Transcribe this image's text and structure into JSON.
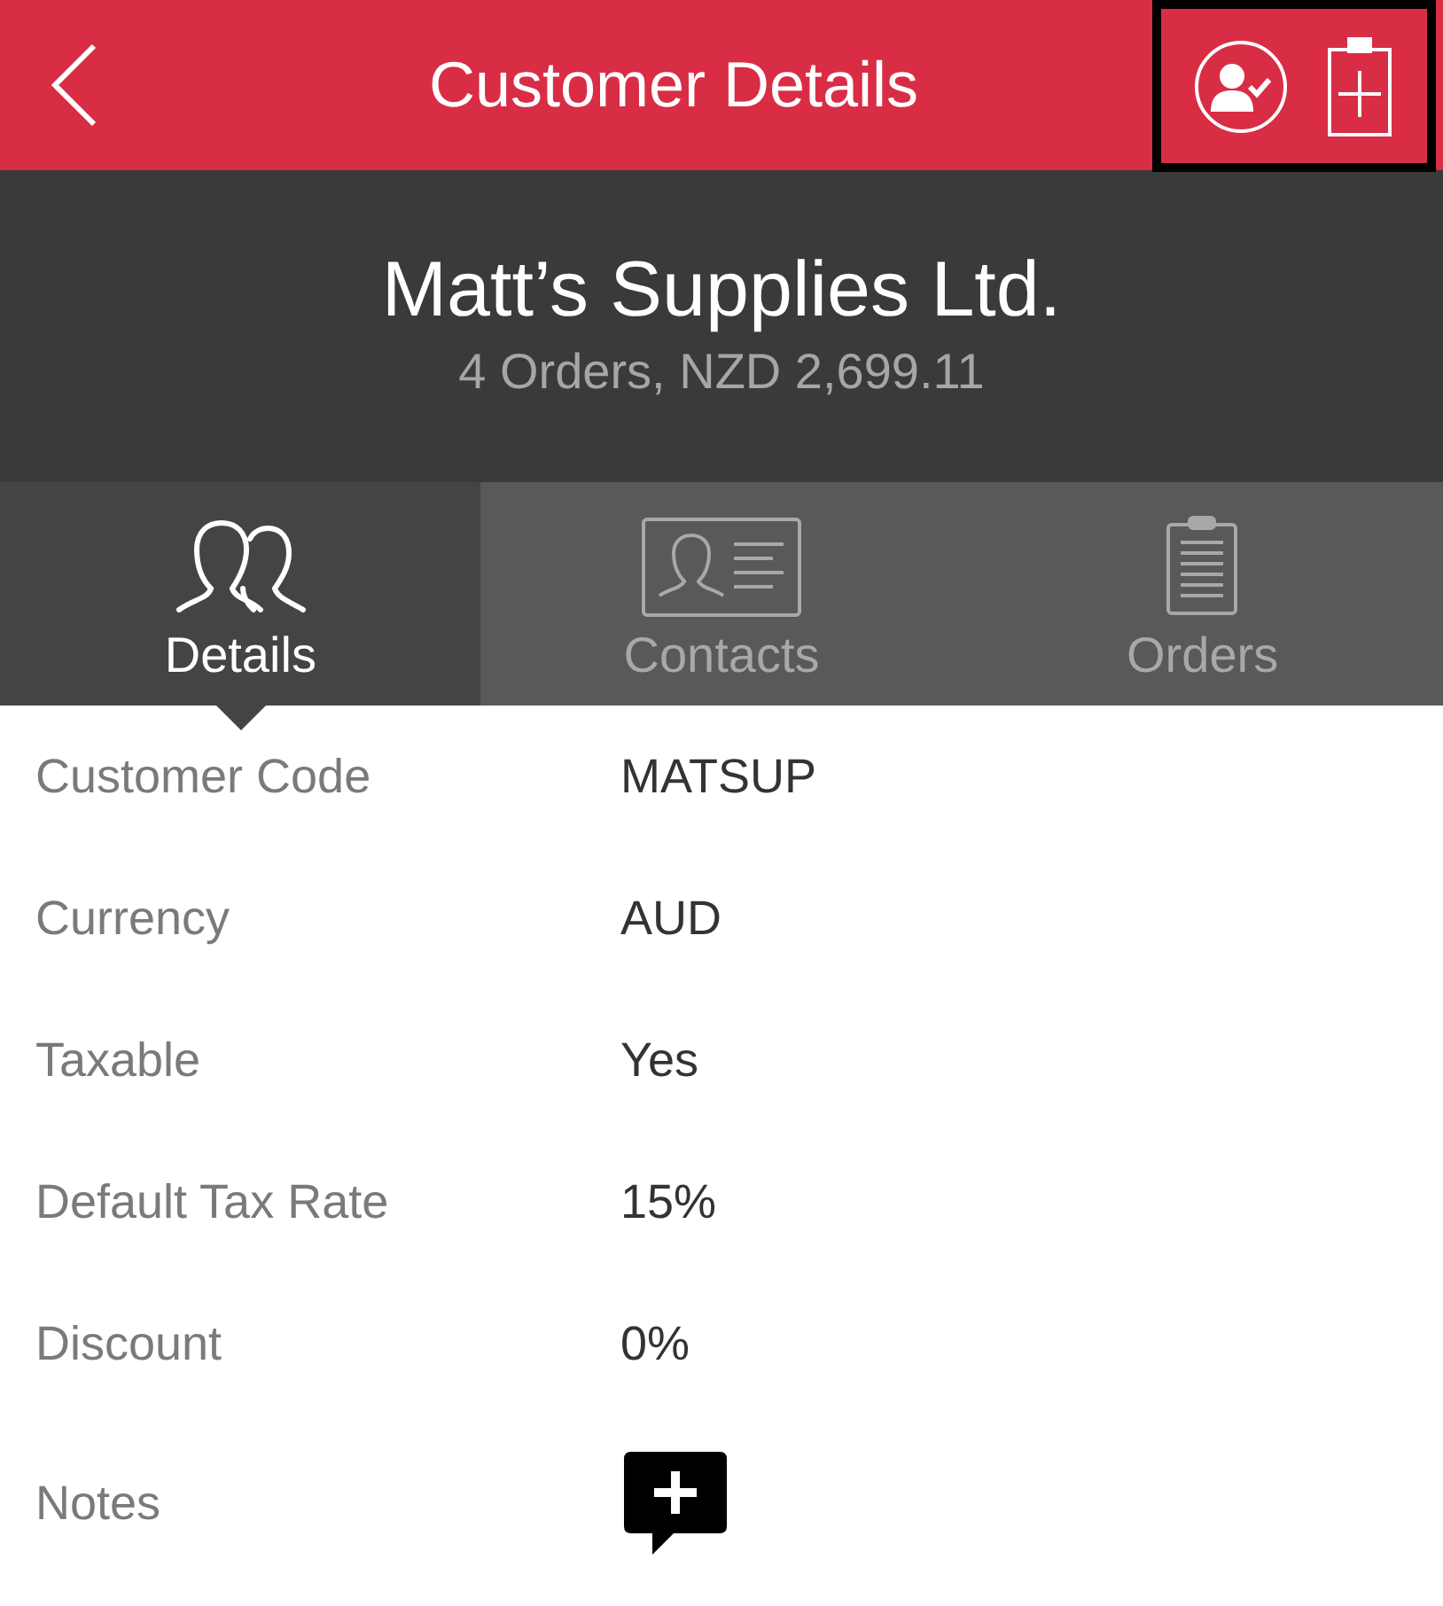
{
  "header": {
    "title": "Customer Details",
    "highlighted": true
  },
  "customer": {
    "name": "Matt’s Supplies Ltd.",
    "summary": "4 Orders, NZD 2,699.11"
  },
  "tabs": [
    {
      "label": "Details",
      "kind": "people",
      "selected": true
    },
    {
      "label": "Contacts",
      "kind": "card",
      "selected": false
    },
    {
      "label": "Orders",
      "kind": "clipboard",
      "selected": false
    }
  ],
  "rows": [
    {
      "label": "Customer Code",
      "kind": "text",
      "value": "MATSUP"
    },
    {
      "label": "Currency",
      "kind": "text",
      "value": "AUD"
    },
    {
      "label": "Taxable",
      "kind": "text",
      "value": "Yes"
    },
    {
      "label": "Default Tax Rate",
      "kind": "text",
      "value": "15%"
    },
    {
      "label": "Discount",
      "kind": "text",
      "value": "0%"
    },
    {
      "label": "Notes",
      "kind": "add-note"
    }
  ]
}
